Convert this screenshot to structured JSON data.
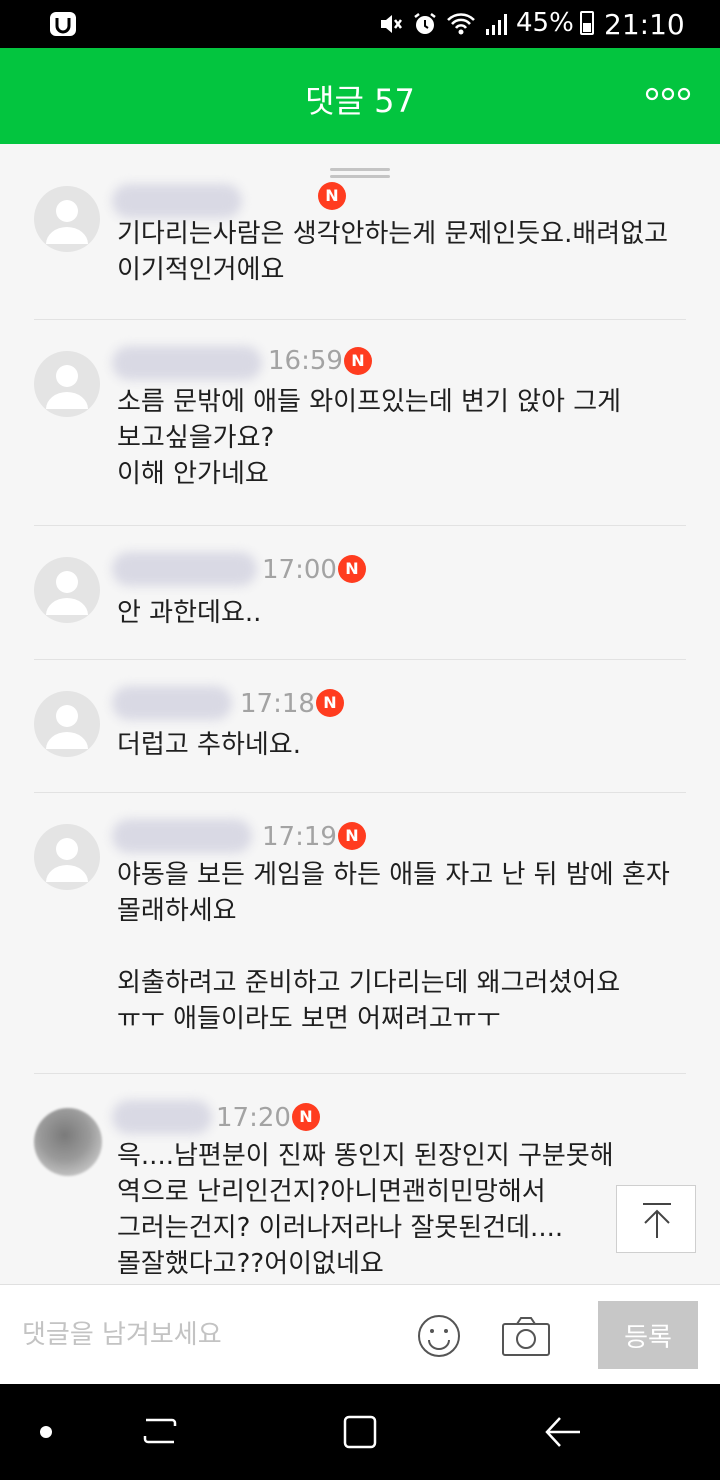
{
  "status_bar": {
    "battery": "45%",
    "time": "21:10"
  },
  "header": {
    "title": "댓글 57"
  },
  "comments": [
    {
      "time": "",
      "has_new_badge": true,
      "text": "기다리는사람은 생각안하는게 문제인듯요.배려없고\n이기적인거에요"
    },
    {
      "time": "16:59",
      "has_new_badge": true,
      "text": "소름 문밖에 애들 와이프있는데 변기 앉아 그게\n보고싶을가요?\n이해 안가네요"
    },
    {
      "time": "17:00",
      "has_new_badge": true,
      "text": "안 과한데요.."
    },
    {
      "time": "17:18",
      "has_new_badge": true,
      "text": "더럽고 추하네요."
    },
    {
      "time": "17:19",
      "has_new_badge": true,
      "text": "야동을 보든 게임을 하든 애들 자고 난 뒤 밤에 혼자\n몰래하세요\n\n외출하려고 준비하고 기다리는데 왜그러셨어요\nㅠㅜ 애들이라도 보면 어쩌려고ㅠㅜ"
    },
    {
      "time": "17:20",
      "has_new_badge": true,
      "text": "윽....남편분이 진짜 똥인지 된장인지 구분못해\n역으로 난리인건지?아니면괜히민망해서\n그러는건지? 이러나저라나 잘못된건데....\n몰잘했다고??어이없네요"
    }
  ],
  "badge_label": "N",
  "input": {
    "placeholder": "댓글을 남겨보세요",
    "submit_label": "등록"
  },
  "colors": {
    "header_green": "#03c53f",
    "new_badge": "#ff3c1f",
    "submit_disabled": "#c7c7c7"
  },
  "icons": {
    "status": [
      "app-icon",
      "mute-icon",
      "alarm-icon",
      "wifi-icon",
      "signal-icon",
      "battery-icon"
    ],
    "header": [
      "more-icon"
    ],
    "input": [
      "emoji-icon",
      "camera-icon"
    ],
    "nav": [
      "recent-apps-icon",
      "home-icon",
      "back-icon"
    ]
  }
}
